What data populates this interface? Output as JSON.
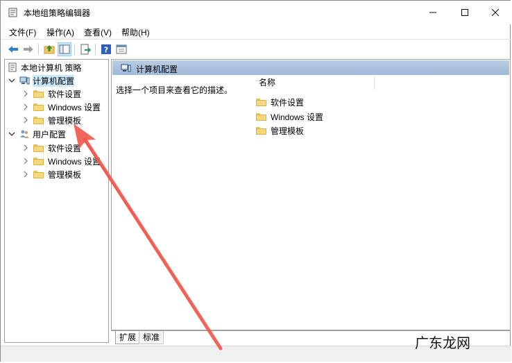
{
  "window": {
    "title": "本地组策略编辑器",
    "controls": {
      "minimize": "minimize-icon",
      "maximize": "maximize-icon",
      "close": "close-icon"
    }
  },
  "menu": [
    {
      "label": "文件(F)"
    },
    {
      "label": "操作(A)"
    },
    {
      "label": "查看(V)"
    },
    {
      "label": "帮助(H)"
    }
  ],
  "toolbar": {
    "icons": [
      "back-arrow-icon",
      "forward-arrow-icon",
      "up-folder-icon",
      "show-hide-tree-icon",
      "export-list-icon",
      "help-icon",
      "properties-icon"
    ]
  },
  "tree": {
    "root": "本地计算机 策略",
    "computer_config": "计算机配置",
    "computer_children": [
      "软件设置",
      "Windows 设置",
      "管理模板"
    ],
    "user_config": "用户配置",
    "user_children": [
      "软件设置",
      "Windows 设置",
      "管理模板"
    ]
  },
  "details": {
    "header_title": "计算机配置",
    "description": "选择一个项目来查看它的描述。",
    "column_name": "名称",
    "items": [
      "软件设置",
      "Windows 设置",
      "管理模板"
    ]
  },
  "tabs": [
    "扩展",
    "标准"
  ],
  "watermark": "广东龙网",
  "colors": {
    "selection": "#cce8ff",
    "header_gradient": "#9fb9d8",
    "annotation_arrow": "#f05a4f"
  }
}
